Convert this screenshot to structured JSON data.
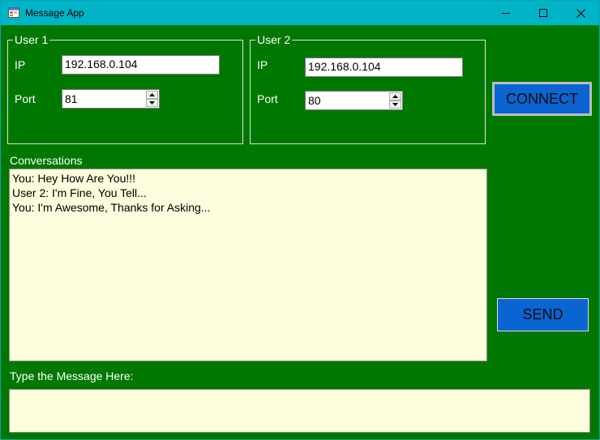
{
  "window": {
    "title": "Message App",
    "background": "#007800",
    "titlebar_color": "#00b4c8"
  },
  "user1": {
    "group_label": "User 1",
    "ip_label": "IP",
    "ip_value": "192.168.0.104",
    "port_label": "Port",
    "port_value": "81"
  },
  "user2": {
    "group_label": "User 2",
    "ip_label": "IP",
    "ip_value": "192.168.0.104",
    "port_label": "Port",
    "port_value": "80"
  },
  "buttons": {
    "connect_label": "CONNECT",
    "send_label": "SEND",
    "color": "#0a64d2"
  },
  "conversations": {
    "label": "Conversations",
    "lines": [
      "You: Hey How Are You!!!",
      "User 2: I'm Fine, You Tell...",
      "You: I'm Awesome, Thanks for Asking..."
    ]
  },
  "message": {
    "label": "Type the Message Here:",
    "value": ""
  }
}
